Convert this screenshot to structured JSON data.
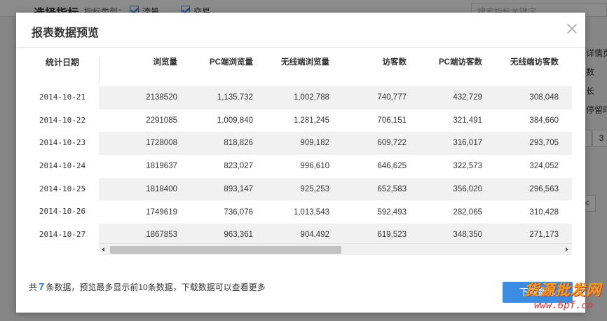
{
  "background": {
    "title": "选择指标",
    "meta_label": "指标类型：",
    "checks": [
      {
        "label": "流量"
      },
      {
        "label": "交易"
      }
    ],
    "search_placeholder": "搜索指标关键字",
    "side_items": [
      "详情页访",
      "数",
      "长",
      "停留时"
    ],
    "pager": [
      "",
      "3"
    ],
    "prev_label": "<"
  },
  "modal": {
    "title": "报表数据预览",
    "table": {
      "date_header": "统计日期",
      "columns": [
        "浏览量",
        "PC端浏览量",
        "无线端浏览量",
        "访客数",
        "PC端访客数",
        "无线端访客数"
      ],
      "rows": [
        {
          "date": "2014-10-21",
          "values": [
            "2138520",
            "1,135,732",
            "1,002,788",
            "740,777",
            "432,729",
            "308,048"
          ]
        },
        {
          "date": "2014-10-22",
          "values": [
            "2291085",
            "1,009,840",
            "1,281,245",
            "706,151",
            "321,491",
            "384,660"
          ]
        },
        {
          "date": "2014-10-23",
          "values": [
            "1728008",
            "818,826",
            "909,182",
            "609,722",
            "316,017",
            "293,705"
          ]
        },
        {
          "date": "2014-10-24",
          "values": [
            "1819637",
            "823,027",
            "996,610",
            "646,625",
            "322,573",
            "324,052"
          ]
        },
        {
          "date": "2014-10-25",
          "values": [
            "1818400",
            "893,147",
            "925,253",
            "652,583",
            "356,020",
            "296,563"
          ]
        },
        {
          "date": "2014-10-26",
          "values": [
            "1749619",
            "736,076",
            "1,013,543",
            "592,493",
            "282,065",
            "310,428"
          ]
        },
        {
          "date": "2014-10-27",
          "values": [
            "1867853",
            "963,361",
            "904,492",
            "619,523",
            "348,350",
            "271,173"
          ]
        }
      ]
    },
    "footer": {
      "prefix": "共",
      "count": "7",
      "suffix": "条数据，预览最多显示前10条数据，下载数据可以查看更多"
    },
    "download_label": "下载数据"
  },
  "watermark": {
    "top": "货源批发网",
    "bottom": "www.6pf.cn"
  },
  "colors": {
    "accent": "#3b8de3",
    "count": "#2d7be5",
    "row_alt": "#f1f1f1"
  }
}
